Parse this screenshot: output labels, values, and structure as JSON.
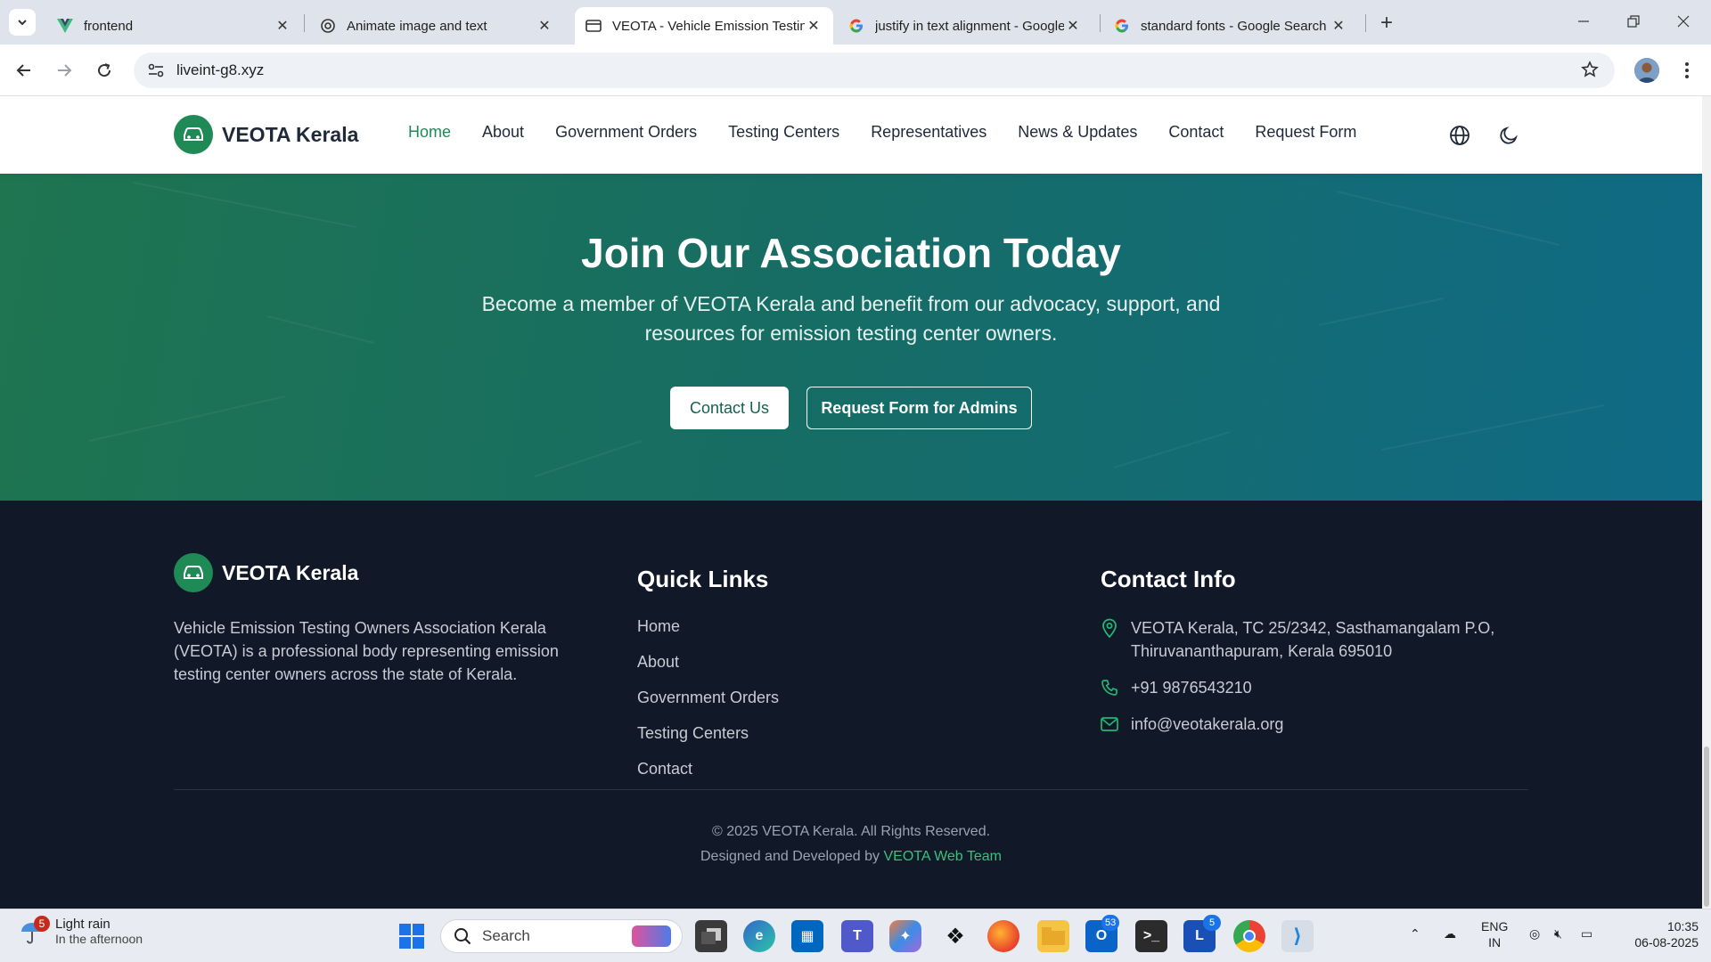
{
  "browser": {
    "tabs": [
      {
        "title": "frontend",
        "active": false
      },
      {
        "title": "Animate image and text",
        "active": false
      },
      {
        "title": "VEOTA - Vehicle Emission Testing",
        "active": true
      },
      {
        "title": "justify in text alignment - Google Search",
        "active": false
      },
      {
        "title": "standard fonts - Google Search",
        "active": false
      }
    ],
    "url": "liveint-g8.xyz"
  },
  "site": {
    "brand": "VEOTA Kerala",
    "nav": [
      "Home",
      "About",
      "Government Orders",
      "Testing Centers",
      "Representatives",
      "News & Updates",
      "Contact",
      "Request Form"
    ],
    "active_nav": "Home",
    "accent_color": "#1f8a55"
  },
  "cta": {
    "title": "Join Our Association Today",
    "subtitle": "Become a member of VEOTA Kerala and benefit from our advocacy, support, and resources for emission testing center owners.",
    "primary_button": "Contact Us",
    "secondary_button": "Request Form for Admins"
  },
  "footer": {
    "brand": "VEOTA Kerala",
    "about": "Vehicle Emission Testing Owners Association Kerala (VEOTA) is a professional body representing emission testing center owners across the state of Kerala.",
    "quick_links_heading": "Quick Links",
    "quick_links": [
      "Home",
      "About",
      "Government Orders",
      "Testing Centers",
      "Contact"
    ],
    "contact_heading": "Contact Info",
    "address": "VEOTA Kerala, TC 25/2342, Sasthamangalam P.O, Thiruvananthapuram, Kerala 695010",
    "phone": "+91 9876543210",
    "email": "info@veotakerala.org",
    "copyright": "© 2025 VEOTA Kerala. All Rights Reserved.",
    "credit_prefix": "Designed and Developed by",
    "credit_team": "VEOTA Web Team"
  },
  "taskbar": {
    "weather_badge": "5",
    "weather_title": "Light rain",
    "weather_sub": "In the afternoon",
    "search_label": "Search",
    "outlook_badge": "53",
    "teams_badge": "5",
    "lang_top": "ENG",
    "lang_bottom": "IN",
    "time": "10:35",
    "date": "06-08-2025",
    "icons": [
      "start-icon",
      "search-icon",
      "copilot-icon",
      "task-view-icon",
      "edge-icon",
      "store-icon",
      "teams-icon",
      "copilot-app-icon",
      "dropbox-icon",
      "firefox-icon",
      "file-explorer-icon",
      "outlook-icon",
      "terminal-icon",
      "lens-icon",
      "chrome-icon",
      "vscode-icon"
    ]
  }
}
